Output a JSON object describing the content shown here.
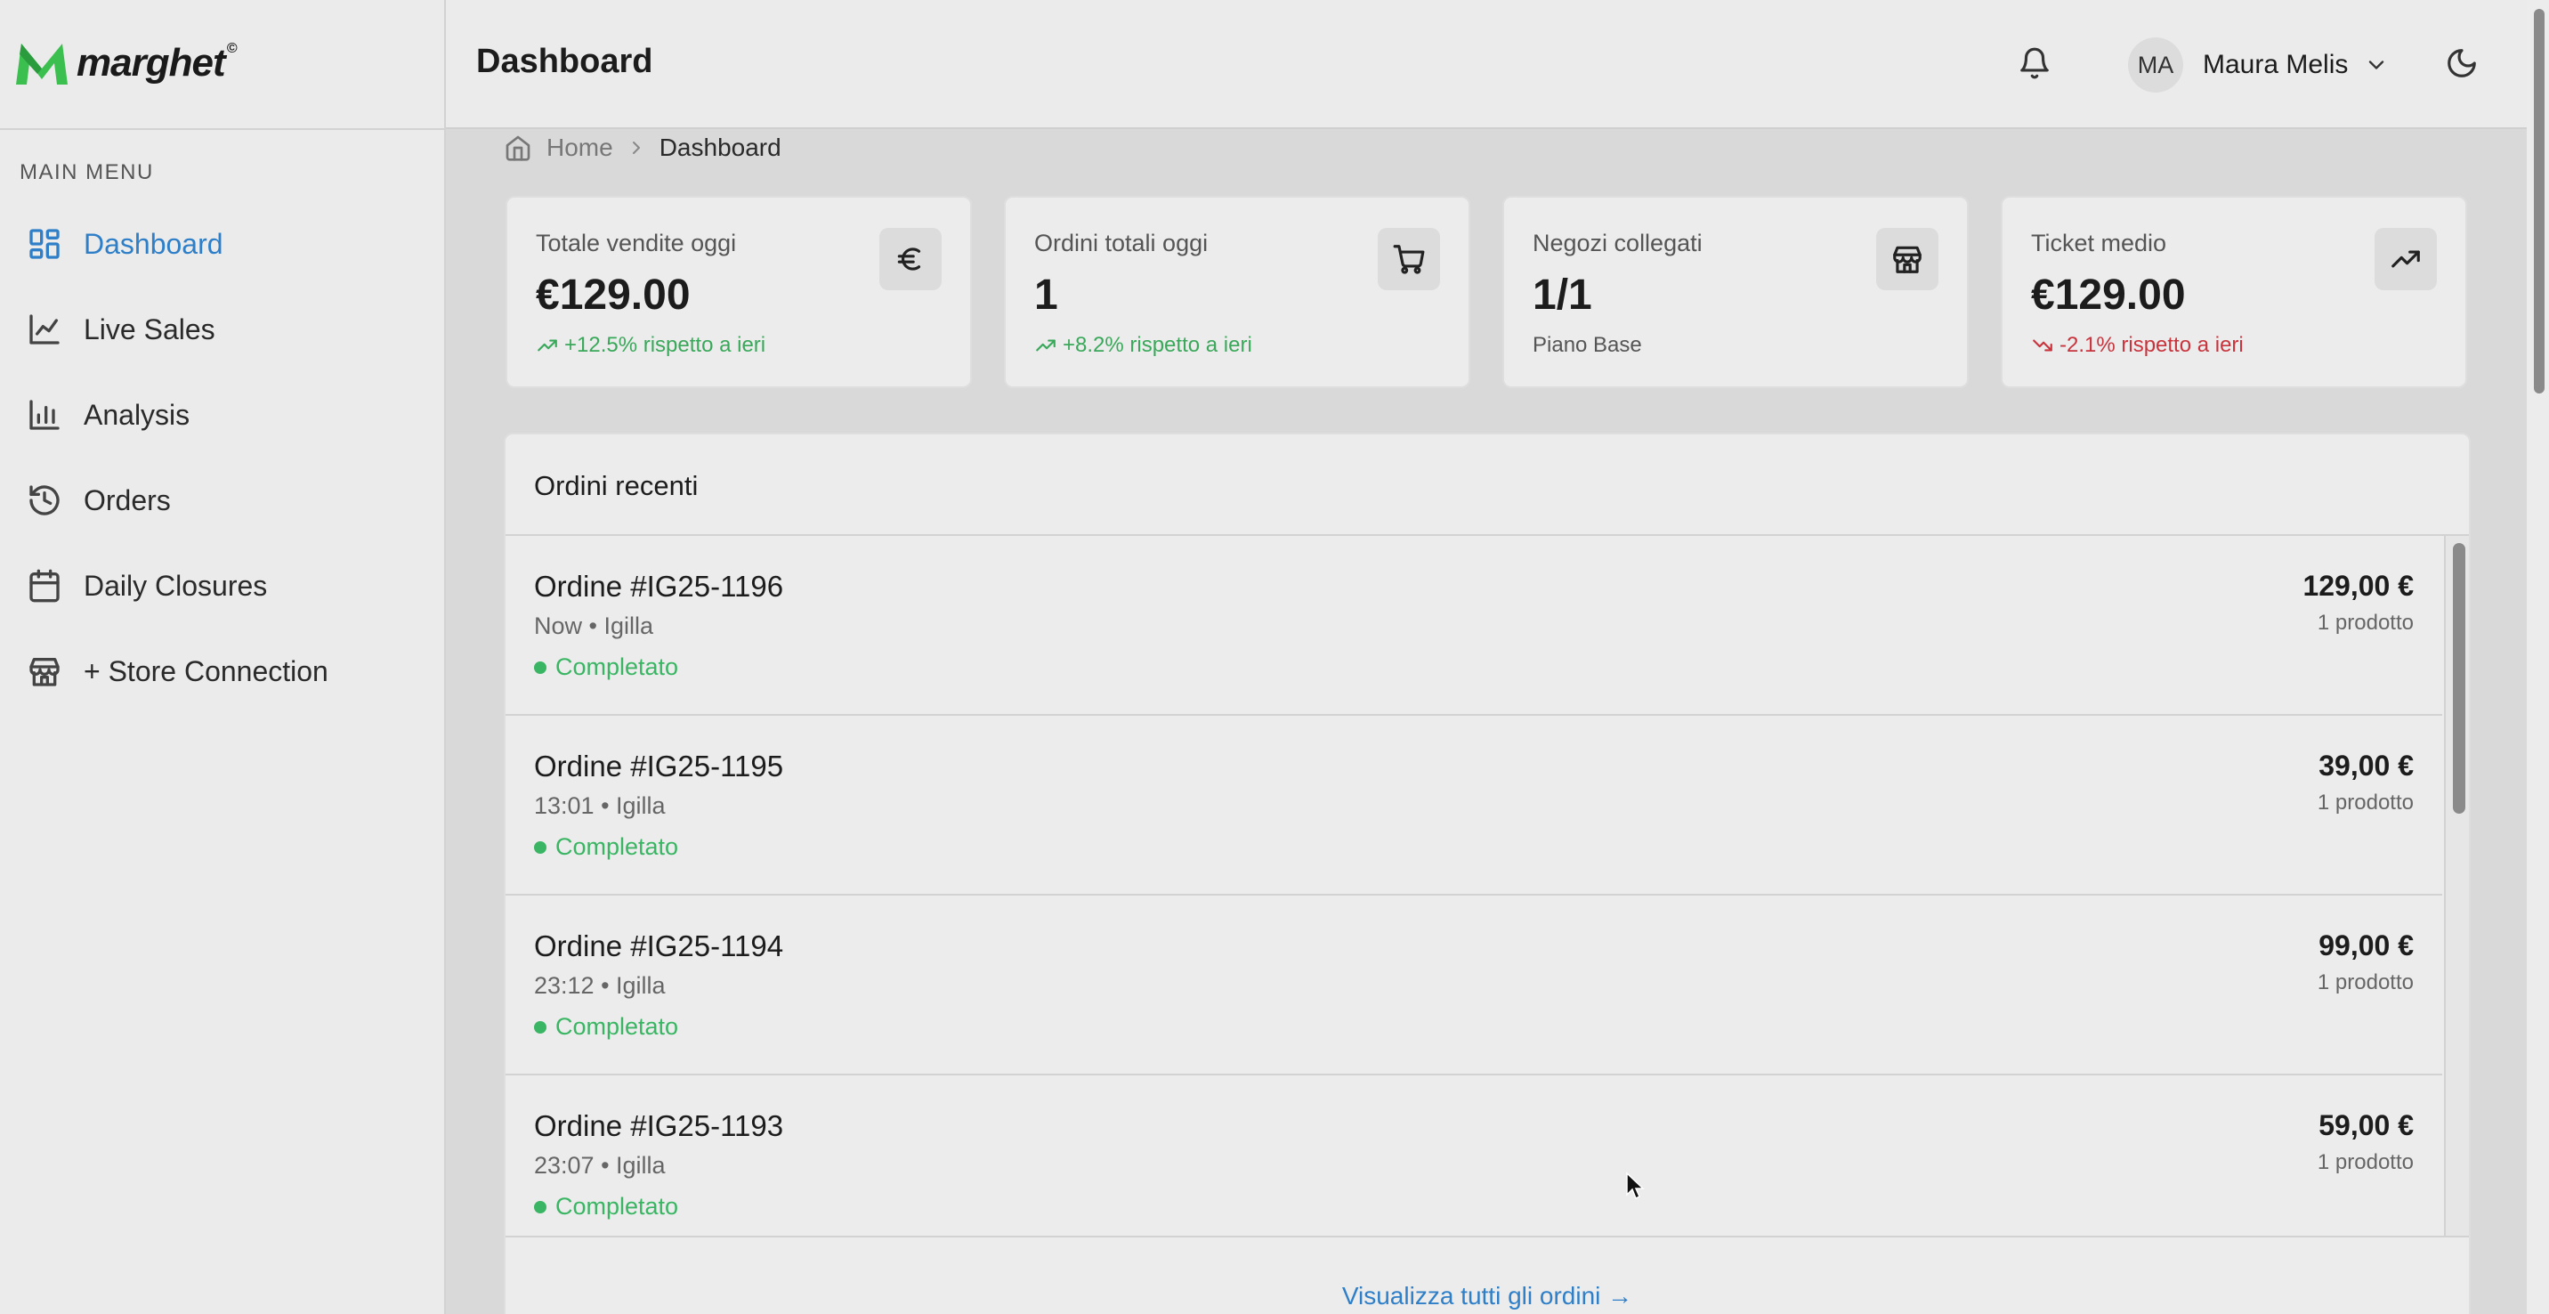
{
  "app": {
    "logo_text": "marghet",
    "logo_mark": "©"
  },
  "sidebar": {
    "menu_title": "MAIN MENU",
    "items": [
      {
        "label": "Dashboard",
        "icon": "grid-icon",
        "active": true
      },
      {
        "label": "Live Sales",
        "icon": "line-chart-icon"
      },
      {
        "label": "Analysis",
        "icon": "bar-chart-icon"
      },
      {
        "label": "Orders",
        "icon": "history-icon"
      },
      {
        "label": "Daily Closures",
        "icon": "calendar-icon"
      },
      {
        "label": "+ Store Connection",
        "icon": "store-icon"
      }
    ]
  },
  "header": {
    "title": "Dashboard",
    "user": {
      "initials": "MA",
      "name": "Maura Melis"
    }
  },
  "breadcrumb": {
    "home": "Home",
    "current": "Dashboard"
  },
  "stats": [
    {
      "title": "Totale vendite oggi",
      "value": "€129.00",
      "note": "+12.5% rispetto a ieri",
      "trend": "up",
      "icon": "euro-icon"
    },
    {
      "title": "Ordini totali oggi",
      "value": "1",
      "note": "+8.2% rispetto a ieri",
      "trend": "up",
      "icon": "cart-icon"
    },
    {
      "title": "Negozi collegati",
      "value": "1/1",
      "note": "Piano Base",
      "trend": "none",
      "icon": "store-icon"
    },
    {
      "title": "Ticket medio",
      "value": "€129.00",
      "note": "-2.1% rispetto a ieri",
      "trend": "down",
      "icon": "trending-up-icon"
    }
  ],
  "orders_panel": {
    "title": "Ordini recenti",
    "view_all": "Visualizza tutti gli ordini →",
    "orders": [
      {
        "title": "Ordine #IG25-1196",
        "meta": "Now • Igilla",
        "status": "Completato",
        "price": "129,00 €",
        "count": "1 prodotto"
      },
      {
        "title": "Ordine #IG25-1195",
        "meta": "13:01 • Igilla",
        "status": "Completato",
        "price": "39,00 €",
        "count": "1 prodotto"
      },
      {
        "title": "Ordine #IG25-1194",
        "meta": "23:12 • Igilla",
        "status": "Completato",
        "price": "99,00 €",
        "count": "1 prodotto"
      },
      {
        "title": "Ordine #IG25-1193",
        "meta": "23:07 • Igilla",
        "status": "Completato",
        "price": "59,00 €",
        "count": "1 prodotto"
      }
    ]
  },
  "colors": {
    "accent": "#2f7fc8",
    "success": "#3ab563",
    "danger": "#c8343d",
    "brand_green": "#3bbf4e"
  }
}
